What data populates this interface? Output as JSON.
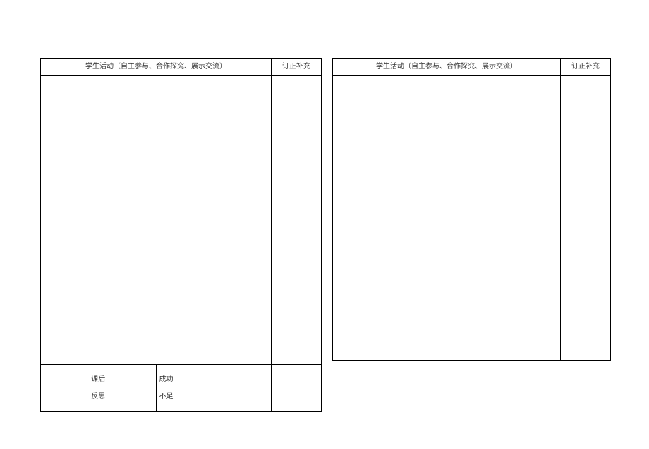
{
  "left": {
    "header_activity": "学生活动（自主参与、合作探究、展示交流）",
    "header_revision": "订正补充",
    "body_activity": "",
    "body_revision": "",
    "reflection_label_line1": "课后",
    "reflection_label_line2": "反思",
    "reflection_content_line1": "成功",
    "reflection_content_line2": "不足",
    "reflection_rest": ""
  },
  "right": {
    "header_activity": "学生活动（自主参与、合作探究、展示交流）",
    "header_revision": "订正补充",
    "body_activity": "",
    "body_revision": ""
  }
}
